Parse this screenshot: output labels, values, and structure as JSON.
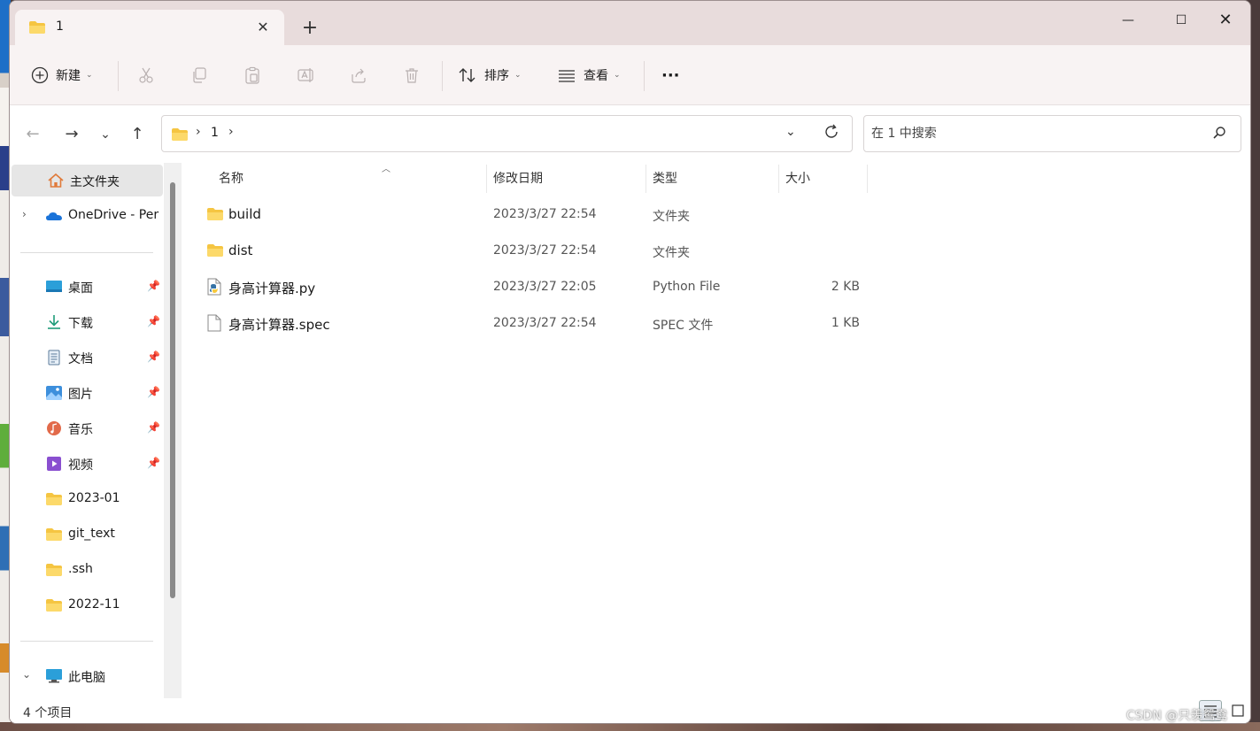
{
  "tab": {
    "label": "1",
    "close": "✕",
    "new": "+"
  },
  "window_controls": {
    "minimize": "—",
    "maximize": "☐",
    "close": "✕"
  },
  "toolbar": {
    "new_label": "新建",
    "sort_label": "排序",
    "view_label": "查看",
    "more_label": "···"
  },
  "address": {
    "crumbs": [
      "1"
    ],
    "separator": "›"
  },
  "search": {
    "placeholder": "在 1 中搜索"
  },
  "sidebar": {
    "home": "主文件夹",
    "onedrive": "OneDrive - Per",
    "quick": [
      {
        "label": "桌面",
        "icon": "desktop-icon",
        "pinned": true
      },
      {
        "label": "下载",
        "icon": "download-icon",
        "pinned": true
      },
      {
        "label": "文档",
        "icon": "documents-icon",
        "pinned": true
      },
      {
        "label": "图片",
        "icon": "pictures-icon",
        "pinned": true
      },
      {
        "label": "音乐",
        "icon": "music-icon",
        "pinned": true
      },
      {
        "label": "视频",
        "icon": "videos-icon",
        "pinned": true
      },
      {
        "label": "2023-01",
        "icon": "folder-icon",
        "pinned": false
      },
      {
        "label": "git_text",
        "icon": "folder-icon",
        "pinned": false
      },
      {
        "label": ".ssh",
        "icon": "folder-icon",
        "pinned": false
      },
      {
        "label": "2022-11",
        "icon": "folder-icon",
        "pinned": false
      }
    ],
    "this_pc": "此电脑"
  },
  "columns": {
    "name": "名称",
    "date": "修改日期",
    "type": "类型",
    "size": "大小"
  },
  "files": [
    {
      "name": "build",
      "date": "2023/3/27 22:54",
      "type": "文件夹",
      "size": "",
      "icon": "folder-icon"
    },
    {
      "name": "dist",
      "date": "2023/3/27 22:54",
      "type": "文件夹",
      "size": "",
      "icon": "folder-icon"
    },
    {
      "name": "身高计算器.py",
      "date": "2023/3/27 22:05",
      "type": "Python File",
      "size": "2 KB",
      "icon": "python-file-icon"
    },
    {
      "name": "身高计算器.spec",
      "date": "2023/3/27 22:54",
      "type": "SPEC 文件",
      "size": "1 KB",
      "icon": "file-icon"
    }
  ],
  "status": {
    "count": "4 个项目"
  },
  "watermark": "CSDN @只羡鸳鸯"
}
